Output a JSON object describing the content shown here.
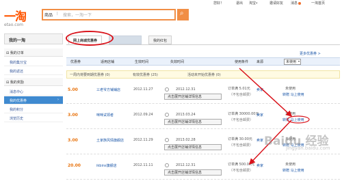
{
  "topbar": {
    "greeting": "您好！",
    "exit": "退出",
    "taobao": "淘宝",
    "invite": "邀请好友",
    "messages": "消息",
    "etao_home": "一淘首页"
  },
  "logo": {
    "main": "一淘",
    "sub": "etao.com"
  },
  "search": {
    "scope": "商品",
    "separator": "|",
    "placeholder": "搜索，一淘一下"
  },
  "sidebar": {
    "title": "我的一淘",
    "groups": [
      {
        "label": "我的订单"
      },
      {
        "label": "我的奖励"
      },
      {
        "label": "我的账户"
      }
    ],
    "items": [
      {
        "label": "我的集分宝"
      },
      {
        "label": "我的返还"
      },
      {
        "label": "消息中心"
      },
      {
        "label": "我的优惠券",
        "chevron": "›"
      },
      {
        "label": "我的积分"
      },
      {
        "label": "浏览历史"
      }
    ]
  },
  "tabs": [
    {
      "label": "网上商城优惠券"
    },
    {
      "label": ""
    },
    {
      "label": "我的红包"
    }
  ],
  "more_link": "更多优惠券 >",
  "table": {
    "headers": [
      "优惠券",
      "适用店铺",
      "生效时间",
      "失效时间",
      "使用条件",
      "来源"
    ],
    "filter_value": "未使用",
    "summary": {
      "expiring": "一周内将要到期优惠券 (0)",
      "valid": "有效优惠券 (25)",
      "activity": "活动未开始优惠券 (0)"
    },
    "rows": [
      {
        "amount": "5.00",
        "shop": "三老爷方铺铺店",
        "from": "2012.11.27",
        "to": "2012.12.31",
        "open": "点击展开店铺详情信息",
        "cond": "订单满 5.01元",
        "cond2": "（不包含邮费）",
        "source": "卖家",
        "status": "未使用",
        "actions": "转赠 马上使用"
      },
      {
        "amount": "3.00",
        "shop": "咪咪试领者",
        "from": "2012.09.24",
        "to": "2013.03.24",
        "open": "点击展开店铺详情信息",
        "cond": "订单满 30000.00元",
        "cond2": "（不包含邮费）",
        "source": "卖家",
        "status": "未使用",
        "actions": "转赠 马上使用"
      },
      {
        "amount": "3.00",
        "shop": "土家族风情旗舰店",
        "from": "2012.11.29",
        "to": "2013.02.28",
        "open": "点击展开店铺详情信息",
        "cond": "订单满 30.00元",
        "cond2": "（不包含邮费）",
        "source": "卖家",
        "status": "未使用",
        "actions": "转赠 马上使用"
      },
      {
        "amount": "20.00",
        "shop": "ikbins旗舰店",
        "from": "2012.11.11",
        "to": "2012.12.31",
        "open": "点击展开店铺详情信息",
        "cond": "订单满 500.00元",
        "cond2": "（不包含邮费）",
        "source": "卖家",
        "status": "未使用",
        "actions": "转赠 马上使用"
      }
    ]
  },
  "watermark": {
    "main": "Baidu 经验",
    "sub": "jingyan.baidu.com"
  },
  "colors": {
    "brand": "#ff5500",
    "search_border": "#f18e45",
    "active_side": "#3f8ad0",
    "annotation": "#d9121a",
    "amount": "#e8720c",
    "link": "#1a56a8"
  }
}
